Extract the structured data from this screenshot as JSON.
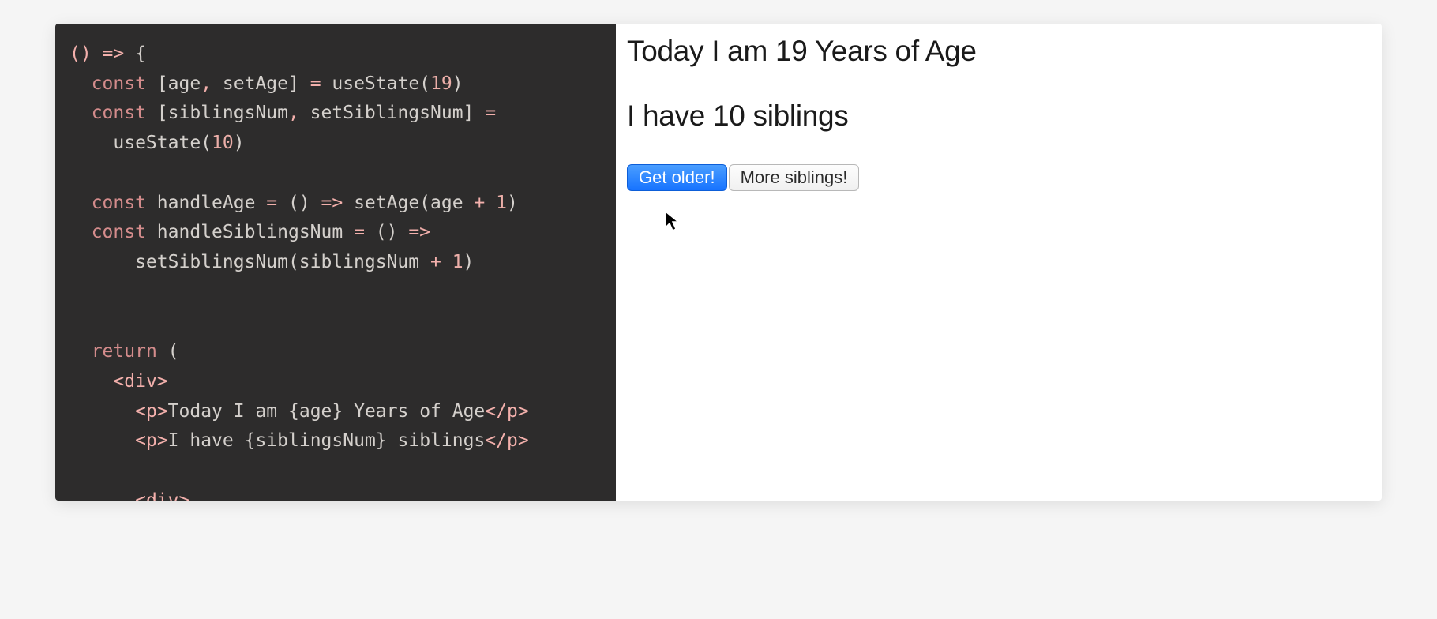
{
  "code": {
    "line1_p1": "() ",
    "line1_arrow": "=>",
    "line1_p2": " {",
    "line2_kw": "const",
    "line2_p1": " [age",
    "line2_comma": ",",
    "line2_p2": " setAge] ",
    "line2_eq": "=",
    "line2_p3": " useState(",
    "line2_num": "19",
    "line2_p4": ")",
    "line3_kw": "const",
    "line3_p1": " [siblingsNum",
    "line3_comma": ",",
    "line3_p2": " setSiblingsNum] ",
    "line3_eq": "=",
    "line4_p1": "    useState(",
    "line4_num": "10",
    "line4_p2": ")",
    "line6_kw": "const",
    "line6_p1": " handleAge ",
    "line6_eq": "=",
    "line6_p2": " () ",
    "line6_arrow": "=>",
    "line6_p3": " setAge(age ",
    "line6_plus": "+",
    "line6_sp": " ",
    "line6_num": "1",
    "line6_p4": ")",
    "line7_kw": "const",
    "line7_p1": " handleSiblingsNum ",
    "line7_eq": "=",
    "line7_p2": " () ",
    "line7_arrow": "=>",
    "line8_p1": "      setSiblingsNum(siblingsNum ",
    "line8_plus": "+",
    "line8_sp": " ",
    "line8_num": "1",
    "line8_p2": ")",
    "line11_kw": "return",
    "line11_p1": " (",
    "line12_p1": "<",
    "line12_tag": "div",
    "line12_p2": ">",
    "line13_p1": "<",
    "line13_tag": "p",
    "line13_p2": ">",
    "line13_text1": "Today I am ",
    "line13_lb": "{",
    "line13_var": "age",
    "line13_rb": "}",
    "line13_text2": " Years of Age",
    "line13_p3": "</",
    "line13_tag2": "p",
    "line13_p4": ">",
    "line14_p1": "<",
    "line14_tag": "p",
    "line14_p2": ">",
    "line14_text1": "I have ",
    "line14_lb": "{",
    "line14_var": "siblingsNum",
    "line14_rb": "}",
    "line14_text2": " siblings",
    "line14_p3": "</",
    "line14_tag2": "p",
    "line14_p4": ">",
    "line16_p1": "<",
    "line16_tag": "div",
    "line16_p2": ">"
  },
  "preview": {
    "line1": "Today I am 19 Years of Age",
    "line2": "I have 10 siblings",
    "button1": "Get older!",
    "button2": "More siblings!"
  }
}
